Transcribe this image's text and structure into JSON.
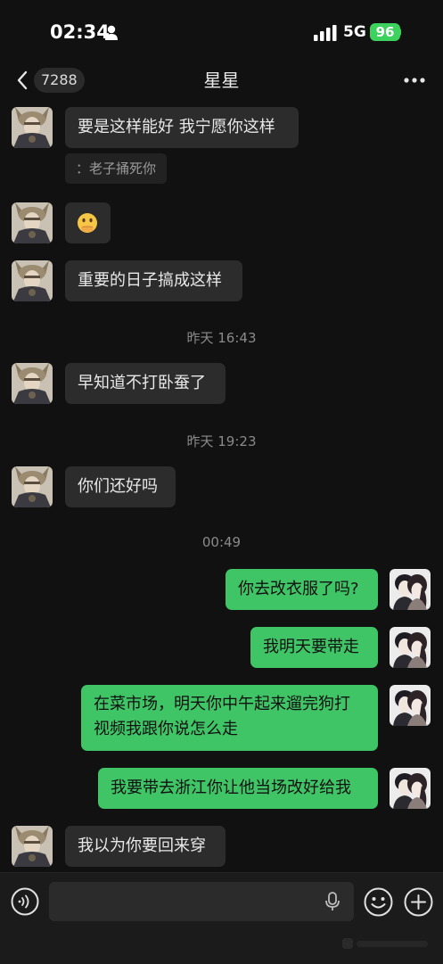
{
  "status_bar": {
    "time": "02:34",
    "network": "5G",
    "battery": "96"
  },
  "header": {
    "back_count": "7288",
    "title": "星星"
  },
  "messages": [
    {
      "side": "in",
      "text": "要是这样能好 我宁愿你这样"
    },
    {
      "quote": "：老子捅死你"
    },
    {
      "side": "in",
      "emoji": "🫢"
    },
    {
      "side": "in",
      "text": "重要的日子搞成这样"
    },
    {
      "timestamp": "昨天 16:43"
    },
    {
      "side": "in",
      "text": "早知道不打卧蚕了"
    },
    {
      "timestamp": "昨天 19:23"
    },
    {
      "side": "in",
      "text": "你们还好吗"
    },
    {
      "timestamp": "00:49"
    },
    {
      "side": "out",
      "text": "你去改衣服了吗?"
    },
    {
      "side": "out",
      "text": "我明天要带走"
    },
    {
      "side": "out",
      "text": "在菜市场，明天你中午起来遛完狗打视频我跟你说怎么走"
    },
    {
      "side": "out",
      "text": "我要带去浙江你让他当场改好给我"
    },
    {
      "side": "in",
      "text": "我以为你要回来穿"
    }
  ],
  "input_bar": {
    "placeholder": ""
  },
  "colors": {
    "background": "#111111",
    "incoming_bubble": "#2c2c2c",
    "outgoing_bubble": "#3fc466",
    "battery": "#3dd15e"
  }
}
